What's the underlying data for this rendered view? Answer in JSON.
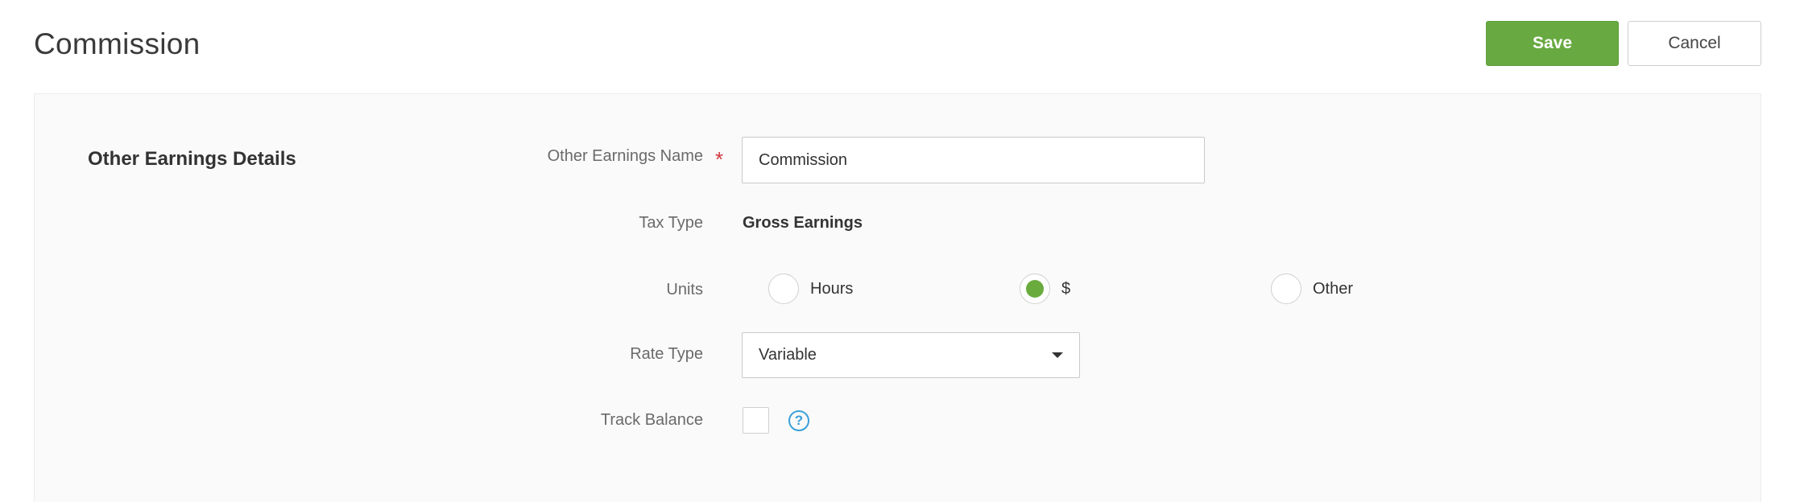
{
  "header": {
    "title": "Commission",
    "save_label": "Save",
    "cancel_label": "Cancel"
  },
  "section": {
    "title": "Other Earnings Details"
  },
  "fields": {
    "name": {
      "label": "Other Earnings Name",
      "required_marker": "*",
      "value": "Commission"
    },
    "tax_type": {
      "label": "Tax Type",
      "value": "Gross Earnings"
    },
    "units": {
      "label": "Units",
      "options": [
        "Hours",
        "$",
        "Other"
      ],
      "selected": "$"
    },
    "rate_type": {
      "label": "Rate Type",
      "value": "Variable"
    },
    "track_balance": {
      "label": "Track Balance",
      "checked": false,
      "help_icon": "question-circle-icon",
      "help_glyph": "?"
    }
  },
  "colors": {
    "accent_green": "#68a941",
    "required_red": "#d0393e",
    "help_blue": "#3aa0d8"
  }
}
